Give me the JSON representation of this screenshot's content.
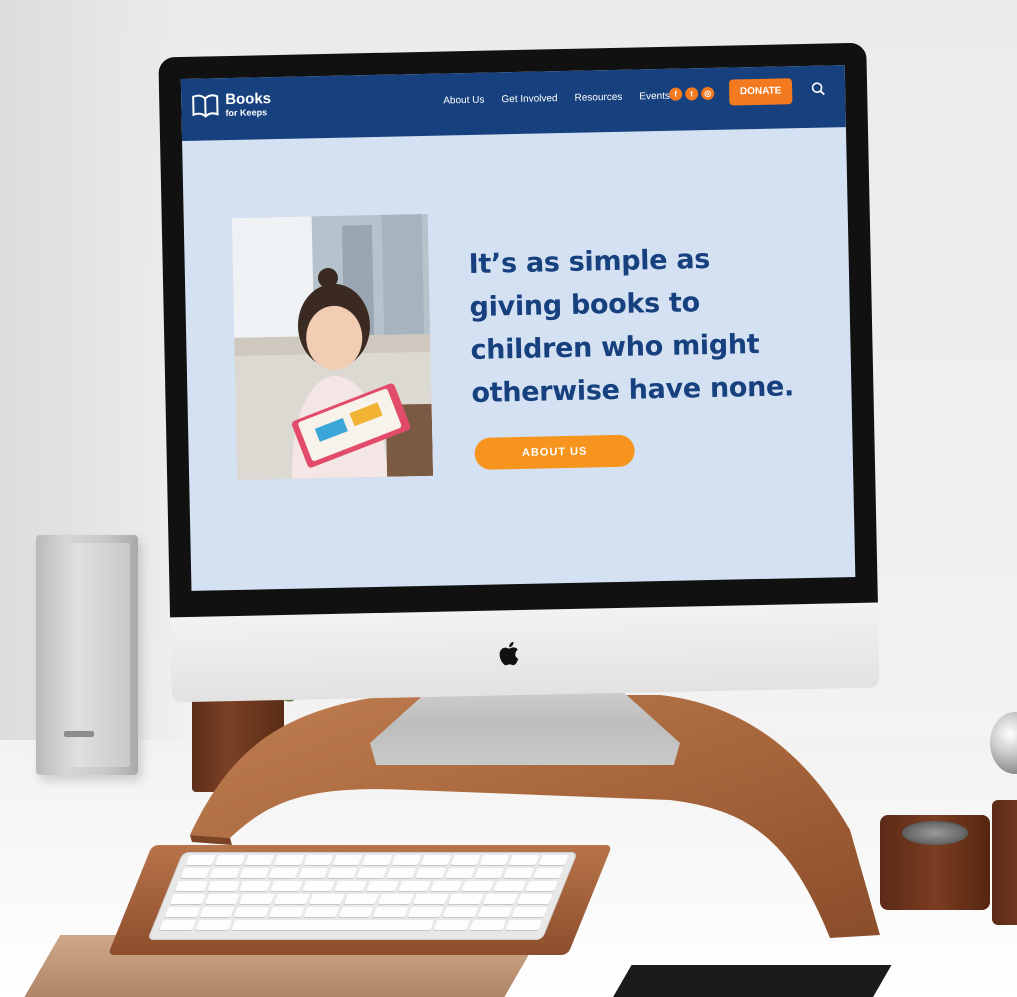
{
  "website": {
    "logo": {
      "main": "Books",
      "sub": "for Keeps"
    },
    "nav": {
      "items": [
        "About Us",
        "Get Involved",
        "Resources",
        "Events"
      ],
      "socials": [
        {
          "icon": "facebook-icon",
          "glyph": "f"
        },
        {
          "icon": "twitter-icon",
          "glyph": "t"
        },
        {
          "icon": "instagram-icon",
          "glyph": "◎"
        }
      ],
      "donate_label": "DONATE"
    },
    "hero": {
      "title": "It’s as simple as giving books to children who might otherwise have none.",
      "button_label": "ABOUT US"
    }
  },
  "colors": {
    "navy": "#17407e",
    "orange": "#f47a20",
    "screen_bg": "#d3e1f3"
  }
}
